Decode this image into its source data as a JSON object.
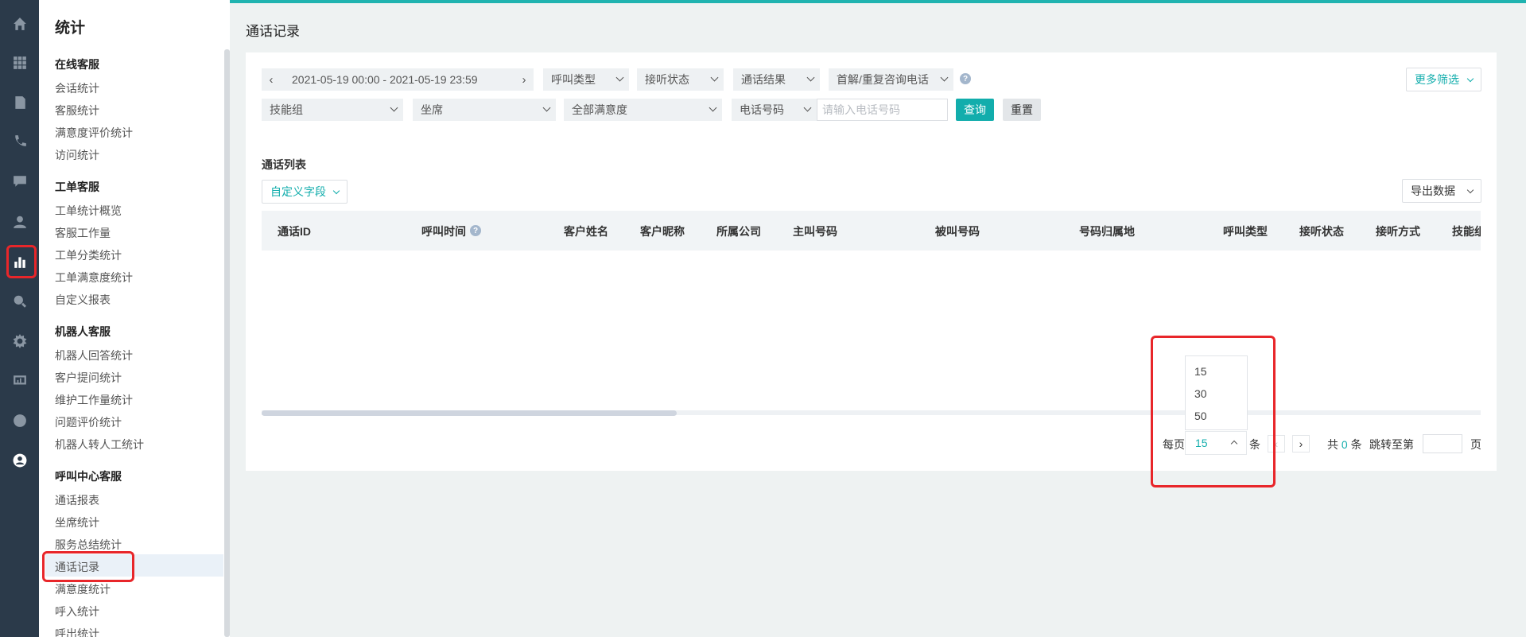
{
  "nav": {
    "title": "统计",
    "groups": [
      {
        "label": "在线客服",
        "items": [
          "会话统计",
          "客服统计",
          "满意度评价统计",
          "访问统计"
        ]
      },
      {
        "label": "工单客服",
        "items": [
          "工单统计概览",
          "客服工作量",
          "工单分类统计",
          "工单满意度统计",
          "自定义报表"
        ]
      },
      {
        "label": "机器人客服",
        "items": [
          "机器人回答统计",
          "客户提问统计",
          "维护工作量统计",
          "问题评价统计",
          "机器人转人工统计"
        ]
      },
      {
        "label": "呼叫中心客服",
        "items": [
          "通话报表",
          "坐席统计",
          "服务总结统计",
          "通话记录",
          "满意度统计",
          "呼入统计",
          "呼出统计"
        ]
      }
    ],
    "active_item": "通话记录"
  },
  "page": {
    "title": "通话记录"
  },
  "filters": {
    "date_range": "2021-05-19 00:00 - 2021-05-19 23:59",
    "call_type": "呼叫类型",
    "answer_status": "接听状态",
    "call_result": "通话结果",
    "first_repeat": "首解/重复咨询电话",
    "more_filter": "更多筛选",
    "skill_group": "技能组",
    "agent": "坐席",
    "satisfaction": "全部满意度",
    "phone_type": "电话号码",
    "phone_placeholder": "请输入电话号码",
    "query": "查询",
    "reset": "重置"
  },
  "list": {
    "title": "通话列表",
    "custom_fields": "自定义字段",
    "export": "导出数据",
    "columns": [
      "通话ID",
      "呼叫时间",
      "客户姓名",
      "客户昵称",
      "所属公司",
      "主叫号码",
      "被叫号码",
      "号码归属地",
      "呼叫类型",
      "接听状态",
      "接听方式",
      "技能组"
    ]
  },
  "pagination": {
    "per_page_label": "每页",
    "per_page_value": "15",
    "unit": "条",
    "options": [
      "15",
      "30",
      "50"
    ],
    "total_prefix": "共",
    "total": "0",
    "total_suffix": "条",
    "jump_label": "跳转至第",
    "page_suffix": "页",
    "prev": "‹",
    "next": "›"
  },
  "colors": {
    "accent": "#12adac",
    "highlight": "#e8262a",
    "rail": "#2b3a4a"
  }
}
